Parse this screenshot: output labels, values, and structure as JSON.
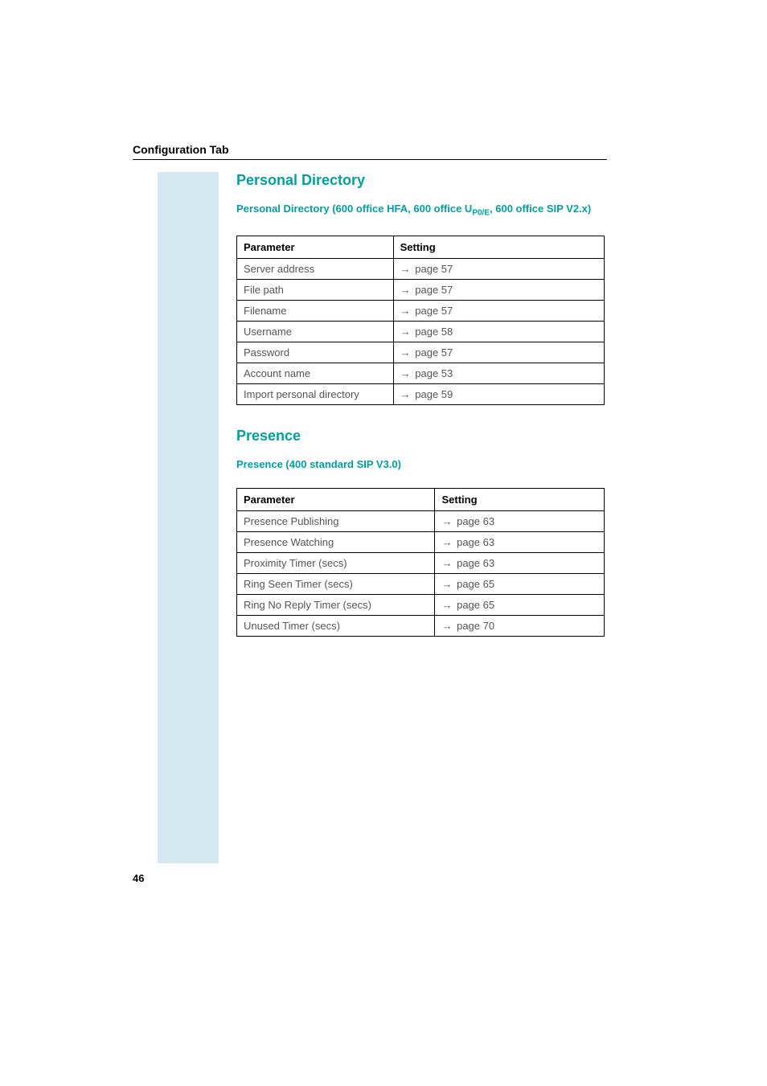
{
  "header": {
    "title": "Configuration Tab"
  },
  "section1": {
    "title": "Personal Directory",
    "subtitle_part1": "Personal Directory (600 office HFA, 600 office U",
    "subtitle_sub": "P0/E",
    "subtitle_part2": ", 600 office SIP V2.x)",
    "table": {
      "headers": {
        "parameter": "Parameter",
        "setting": "Setting"
      },
      "rows": [
        {
          "param": "Server address",
          "setting": "page 57"
        },
        {
          "param": "File path",
          "setting": "page 57"
        },
        {
          "param": "Filename",
          "setting": "page 57"
        },
        {
          "param": "Username",
          "setting": "page 58"
        },
        {
          "param": "Password",
          "setting": "page 57"
        },
        {
          "param": "Account name",
          "setting": "page 53"
        },
        {
          "param": "Import personal directory",
          "setting": "page 59"
        }
      ]
    }
  },
  "section2": {
    "title": "Presence",
    "subtitle": "Presence (400 standard SIP V3.0)",
    "table": {
      "headers": {
        "parameter": "Parameter",
        "setting": "Setting"
      },
      "rows": [
        {
          "param": "Presence Publishing",
          "setting": "page 63"
        },
        {
          "param": "Presence Watching",
          "setting": "page 63"
        },
        {
          "param": "Proximity Timer (secs)",
          "setting": "page 63"
        },
        {
          "param": "Ring Seen Timer (secs)",
          "setting": "page 65"
        },
        {
          "param": "Ring No Reply Timer (secs)",
          "setting": "page 65"
        },
        {
          "param": "Unused Timer (secs)",
          "setting": "page 70"
        }
      ]
    }
  },
  "footer": {
    "page_number": "46"
  },
  "arrow_symbol": "→"
}
